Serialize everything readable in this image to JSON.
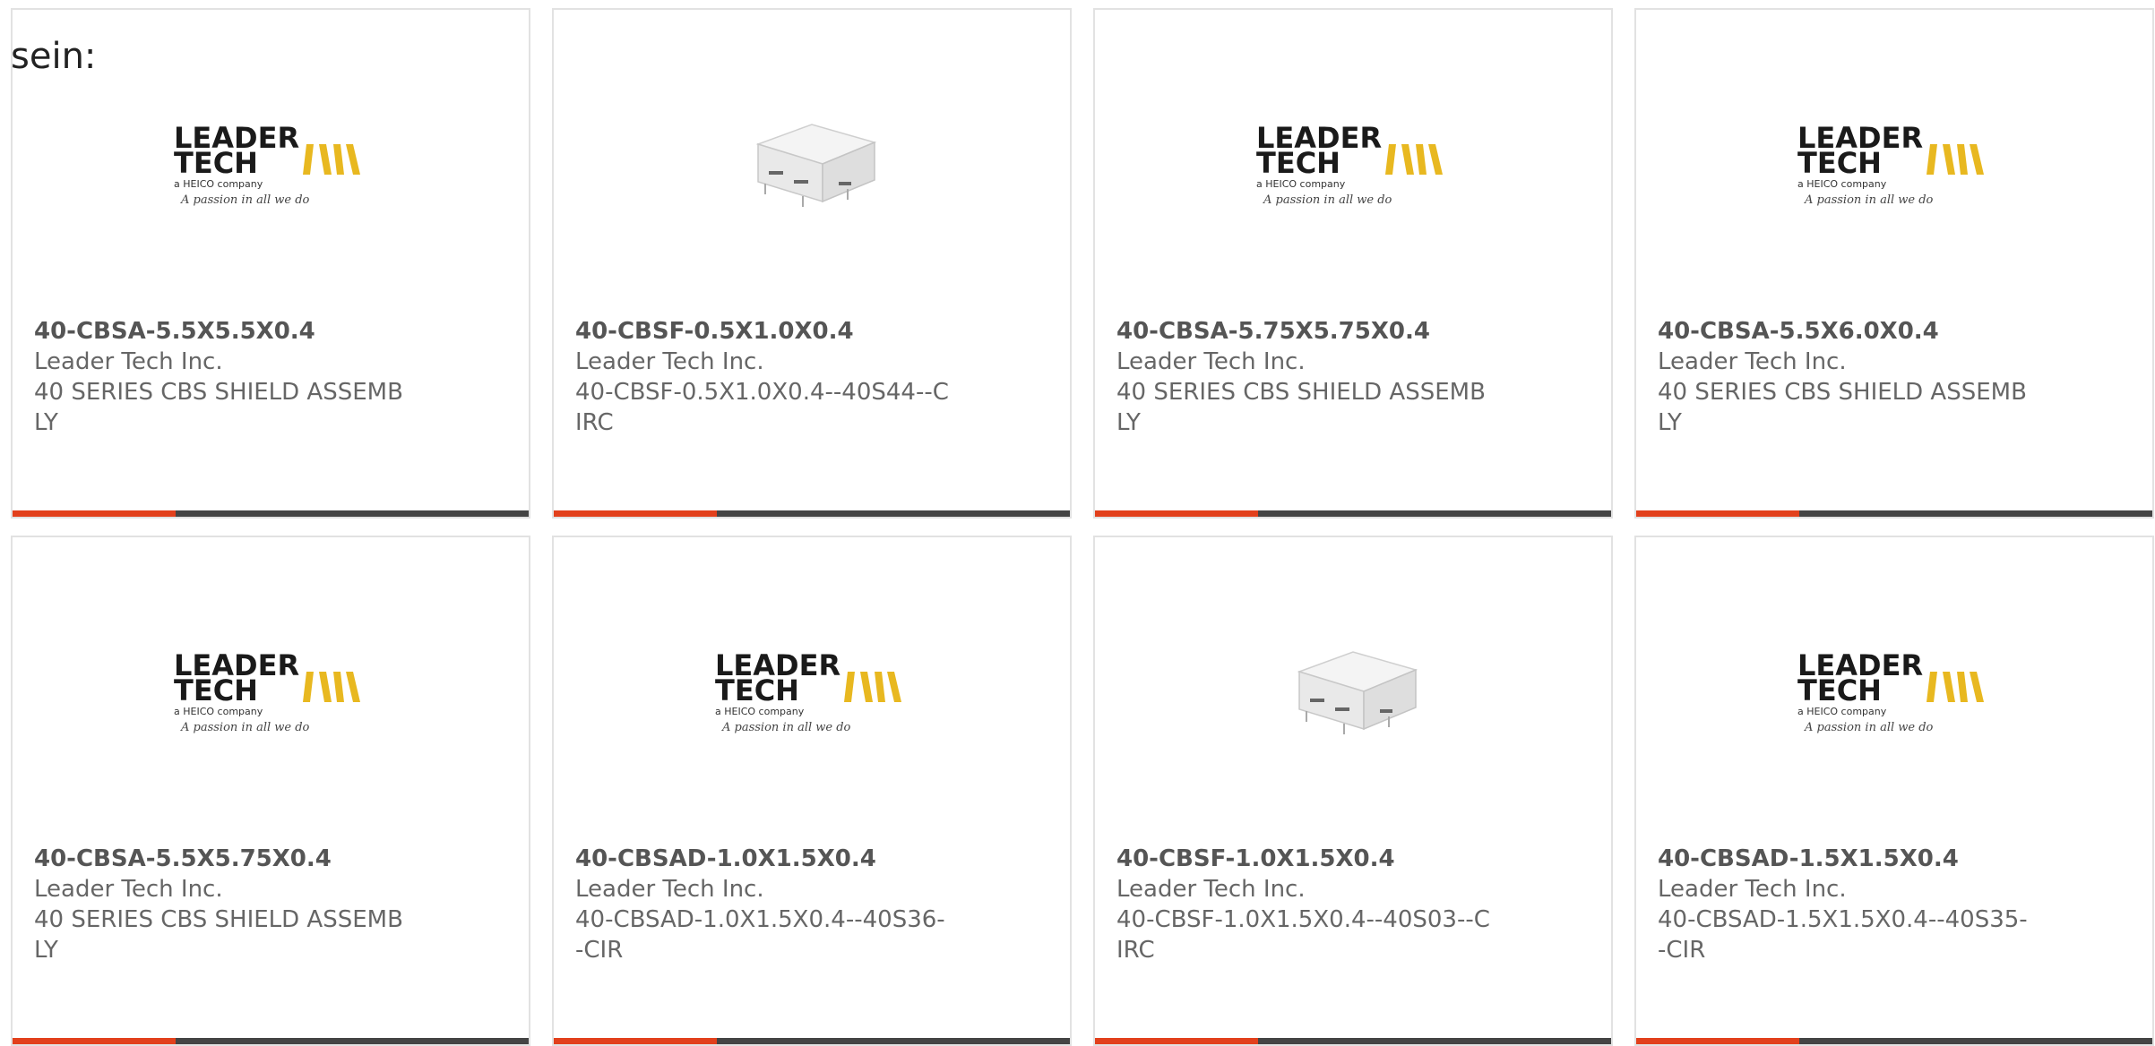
{
  "intro_text": "sein:",
  "colors": {
    "accent": "#e2401c",
    "bar_dark": "#444444",
    "logo_yellow": "#e8b820"
  },
  "products": [
    {
      "part_number": "40-CBSA-5.5X5.5X0.4",
      "manufacturer": "Leader Tech Inc.",
      "description": "40 SERIES CBS SHIELD ASSEMBLY",
      "image": "leader-tech-logo",
      "logo": {
        "line1": "LEADER",
        "line2": "TECH",
        "line3": "a HEICO company",
        "tagline": "A passion in all we do"
      }
    },
    {
      "part_number": "40-CBSF-0.5X1.0X0.4",
      "manufacturer": "Leader Tech Inc.",
      "description": "40-CBSF-0.5X1.0X0.4--40S44--CIRC",
      "image": "shield-component-photo",
      "logo": null
    },
    {
      "part_number": "40-CBSA-5.75X5.75X0.4",
      "manufacturer": "Leader Tech Inc.",
      "description": "40 SERIES CBS SHIELD ASSEMBLY",
      "image": "leader-tech-logo",
      "logo": {
        "line1": "LEADER",
        "line2": "TECH",
        "line3": "a HEICO company",
        "tagline": "A passion in all we do"
      }
    },
    {
      "part_number": "40-CBSA-5.5X6.0X0.4",
      "manufacturer": "Leader Tech Inc.",
      "description": "40 SERIES CBS SHIELD ASSEMBLY",
      "image": "leader-tech-logo",
      "logo": {
        "line1": "LEADER",
        "line2": "TECH",
        "line3": "a HEICO company",
        "tagline": "A passion in all we do"
      }
    },
    {
      "part_number": "40-CBSA-5.5X5.75X0.4",
      "manufacturer": "Leader Tech Inc.",
      "description": "40 SERIES CBS SHIELD ASSEMBLY",
      "image": "leader-tech-logo",
      "logo": {
        "line1": "LEADER",
        "line2": "TECH",
        "line3": "a HEICO company",
        "tagline": "A passion in all we do"
      }
    },
    {
      "part_number": "40-CBSAD-1.0X1.5X0.4",
      "manufacturer": "Leader Tech Inc.",
      "description": "40-CBSAD-1.0X1.5X0.4--40S36--CIR",
      "image": "leader-tech-logo",
      "logo": {
        "line1": "LEADER",
        "line2": "TECH",
        "line3": "a HEICO company",
        "tagline": "A passion in all we do"
      }
    },
    {
      "part_number": "40-CBSF-1.0X1.5X0.4",
      "manufacturer": "Leader Tech Inc.",
      "description": "40-CBSF-1.0X1.5X0.4--40S03--CIRC",
      "image": "shield-component-photo",
      "logo": null
    },
    {
      "part_number": "40-CBSAD-1.5X1.5X0.4",
      "manufacturer": "Leader Tech Inc.",
      "description": "40-CBSAD-1.5X1.5X0.4--40S35--CIR",
      "image": "leader-tech-logo",
      "logo": {
        "line1": "LEADER",
        "line2": "TECH",
        "line3": "a HEICO company",
        "tagline": "A passion in all we do"
      }
    }
  ]
}
